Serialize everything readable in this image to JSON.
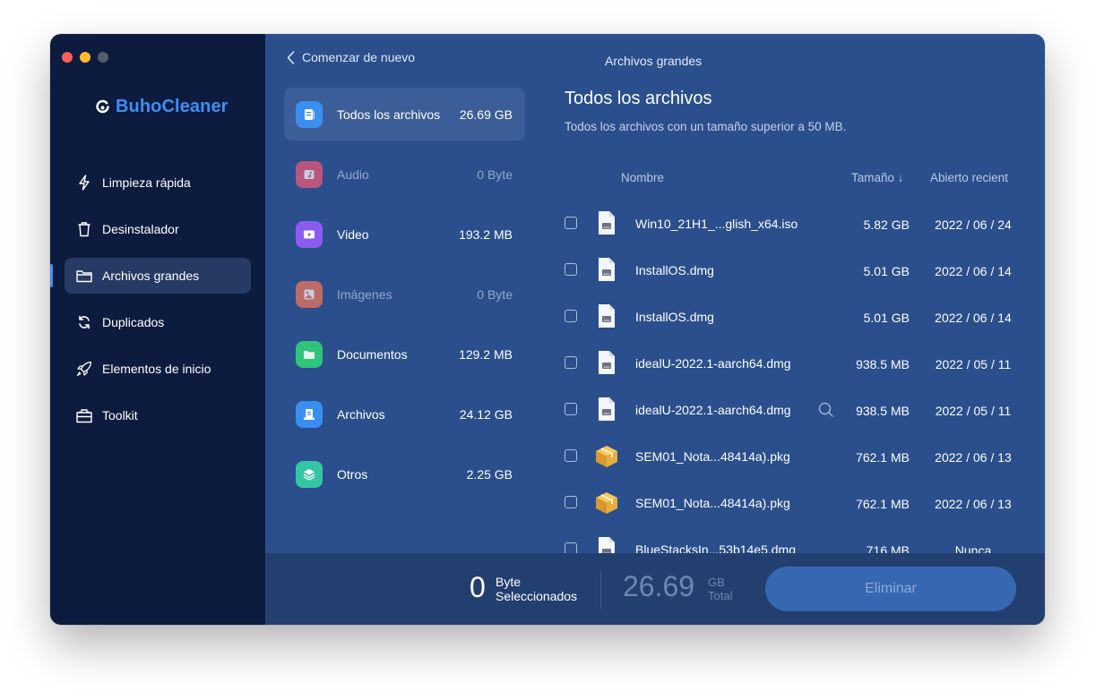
{
  "app": {
    "name": "BuhoCleaner",
    "window_title": "Archivos grandes"
  },
  "sidebar": {
    "items": [
      {
        "label": "Limpieza rápida",
        "icon": "bolt-icon"
      },
      {
        "label": "Desinstalador",
        "icon": "trash-icon"
      },
      {
        "label": "Archivos grandes",
        "icon": "folder-icon",
        "active": true
      },
      {
        "label": "Duplicados",
        "icon": "sync-icon"
      },
      {
        "label": "Elementos de inicio",
        "icon": "rocket-icon"
      },
      {
        "label": "Toolkit",
        "icon": "toolbox-icon"
      }
    ]
  },
  "header": {
    "back_label": "Comenzar de nuevo"
  },
  "categories": [
    {
      "name": "Todos los archivos",
      "size": "26.69 GB",
      "icon": "all-files-icon",
      "color": "#3a8ef0"
    },
    {
      "name": "Audio",
      "size": "0 Byte",
      "icon": "audio-icon",
      "color": "#f25a78"
    },
    {
      "name": "Video",
      "size": "193.2 MB",
      "icon": "video-icon",
      "color": "#8b5cf0"
    },
    {
      "name": "Imágenes",
      "size": "0 Byte",
      "icon": "image-icon",
      "color": "#f5775a"
    },
    {
      "name": "Documentos",
      "size": "129.2 MB",
      "icon": "documents-icon",
      "color": "#2fc47b"
    },
    {
      "name": "Archivos",
      "size": "24.12 GB",
      "icon": "archive-icon",
      "color": "#3a8ef0"
    },
    {
      "name": "Otros",
      "size": "2.25 GB",
      "icon": "layers-icon",
      "color": "#34c6a4"
    }
  ],
  "content": {
    "title": "Todos los archivos",
    "subtitle": "Todos los archivos con un tamaño superior a 50 MB.",
    "columns": {
      "name": "Nombre",
      "size": "Tamaño ↓",
      "opened": "Abierto recient"
    }
  },
  "files": [
    {
      "name": "Win10_21H1_...glish_x64.iso",
      "size": "5.82 GB",
      "opened": "2022 / 06 / 24",
      "type": "disk"
    },
    {
      "name": "InstallOS.dmg",
      "size": "5.01 GB",
      "opened": "2022 / 06 / 14",
      "type": "disk"
    },
    {
      "name": "InstallOS.dmg",
      "size": "5.01 GB",
      "opened": "2022 / 06 / 14",
      "type": "disk"
    },
    {
      "name": "idealU-2022.1-aarch64.dmg",
      "size": "938.5 MB",
      "opened": "2022 / 05 / 11",
      "type": "disk"
    },
    {
      "name": "idealU-2022.1-aarch64.dmg",
      "size": "938.5 MB",
      "opened": "2022 / 05 / 11",
      "type": "disk",
      "hover": true
    },
    {
      "name": "SEM01_Nota...48414a).pkg",
      "size": "762.1 MB",
      "opened": "2022 / 06 / 13",
      "type": "package"
    },
    {
      "name": "SEM01_Nota...48414a).pkg",
      "size": "762.1 MB",
      "opened": "2022 / 06 / 13",
      "type": "package"
    },
    {
      "name": "BlueStacksIn...53b14e5.dmg",
      "size": "716 MB",
      "opened": "Nunca",
      "type": "disk"
    }
  ],
  "footer": {
    "selected_value": "0",
    "selected_unit": "Byte",
    "selected_label": "Seleccionados",
    "total_value": "26.69",
    "total_unit": "GB",
    "total_label": "Total",
    "delete_label": "Eliminar"
  }
}
